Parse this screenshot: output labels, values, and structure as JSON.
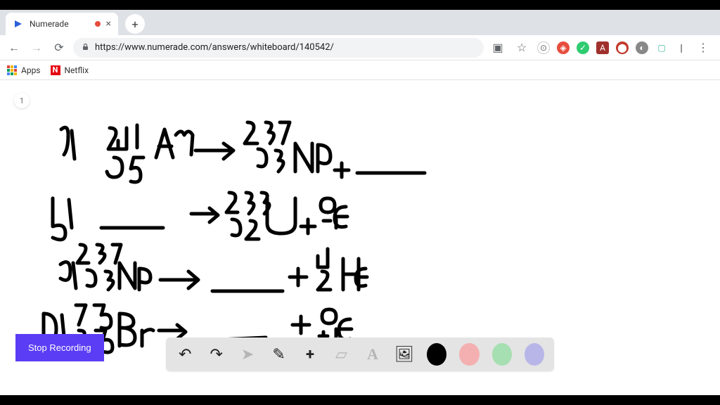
{
  "tab": {
    "title": "Numerade",
    "close": "×",
    "new": "+"
  },
  "nav": {
    "back": "←",
    "forward": "→",
    "reload": "⟳"
  },
  "url": {
    "text": "https://www.numerade.com/answers/whiteboard/140542/"
  },
  "ext": {
    "cast": "▣",
    "star": "☆"
  },
  "bookmarks": {
    "apps": "Apps",
    "netflix": "Netflix",
    "n_icon": "N"
  },
  "page_badge": "1",
  "stop_recording": "Stop Recording",
  "toolbar": {
    "undo": "↶",
    "redo": "↷",
    "cursor": "➤",
    "pen": "✎",
    "add": "+",
    "eraser": "▱",
    "text": "A",
    "image": "🖼",
    "more": "⋮"
  },
  "colors": {
    "black": "#000000",
    "pink": "#f4b0b0",
    "green": "#a6dfb1",
    "purple": "#b8b6e8"
  }
}
